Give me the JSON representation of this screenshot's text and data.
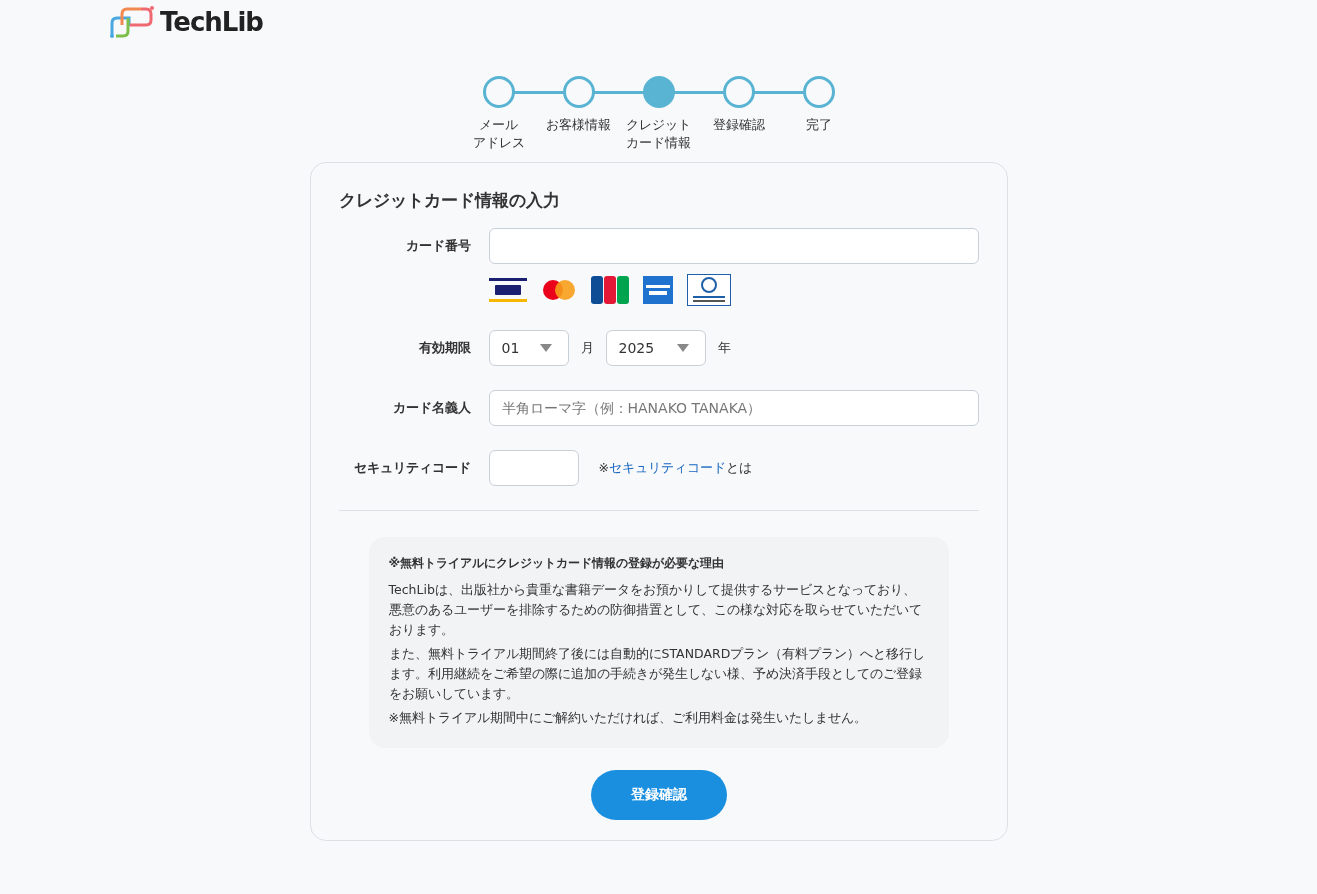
{
  "logo": {
    "text": "TechLib"
  },
  "steps": [
    {
      "lines": [
        "メール",
        "アドレス"
      ],
      "selected": false
    },
    {
      "lines": [
        "お客様情報"
      ],
      "selected": false
    },
    {
      "lines": [
        "クレジット",
        "カード情報"
      ],
      "selected": true
    },
    {
      "lines": [
        "登録確認"
      ],
      "selected": false
    },
    {
      "lines": [
        "完了"
      ],
      "selected": false
    }
  ],
  "form": {
    "title": "クレジットカード情報の入力",
    "card_number": {
      "label": "カード番号"
    },
    "expiry": {
      "label": "有効期限",
      "month": "01",
      "month_unit": "月",
      "year": "2025",
      "year_unit": "年"
    },
    "holder": {
      "label": "カード名義人",
      "placeholder": "半角ローマ字（例：HANAKO TANAKA）"
    },
    "security": {
      "label": "セキュリティコード",
      "note_prefix": "※",
      "link": "セキュリティコード",
      "note_suffix": "とは"
    }
  },
  "notice": {
    "title": "※無料トライアルにクレジットカード情報の登録が必要な理由",
    "paragraphs": [
      "TechLibは、出版社から貴重な書籍データをお預かりして提供するサービスとなっており、悪意のあるユーザーを排除するための防御措置として、この様な対応を取らせていただいております。",
      "また、無料トライアル期間終了後には自動的にSTANDARDプラン（有料プラン）へと移行します。利用継続をご希望の際に追加の手続きが発生しない様、予め決済手段としてのご登録をお願いしています。",
      "※無料トライアル期間中にご解約いただければ、ご利用料金は発生いたしません。"
    ]
  },
  "submit": "登録確認"
}
